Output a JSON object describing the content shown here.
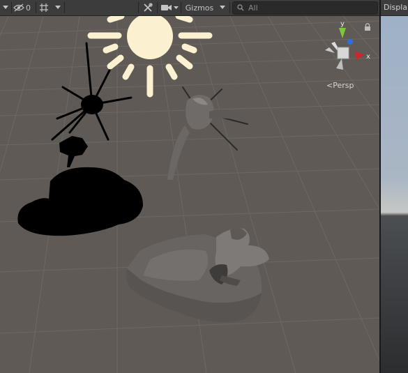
{
  "toolbar": {
    "hidden_count": "0",
    "gizmos_label": "Gizmos",
    "search_placeholder": "All"
  },
  "scene": {
    "projection_label": "Persp",
    "axis_y_label": "y",
    "axis_x_label": "x"
  },
  "game_view": {
    "tab_label": "Displa"
  },
  "colors": {
    "sun_icon": "#fbf0cf",
    "toolbar_bg": "#3c3c3c",
    "grid_bg": "#5f5a55",
    "axis_x": "#d1242b",
    "axis_y": "#7cc83a",
    "axis_z": "#2f6ee0"
  },
  "icons": [
    "menu-dropdown-icon",
    "eye-hidden-icon",
    "grid-snap-icon",
    "tools-icon",
    "camera-icon",
    "search-icon",
    "lock-icon",
    "sun-light-icon"
  ]
}
